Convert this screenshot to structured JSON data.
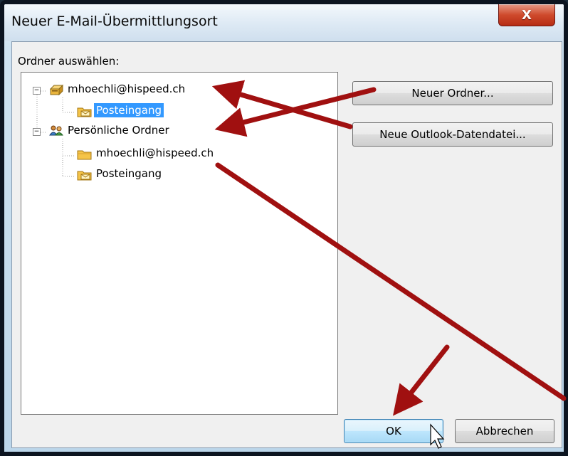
{
  "window": {
    "title": "Neuer E-Mail-Übermittlungsort",
    "close_glyph": "X"
  },
  "tree_label": "Ordner auswählen:",
  "tree": {
    "items": [
      {
        "label": "mhoechli@hispeed.ch",
        "icon": "mailbox-icon",
        "expander": "−"
      },
      {
        "label": "Posteingang",
        "icon": "inbox-folder-icon",
        "selected": true
      },
      {
        "label": "Persönliche Ordner",
        "icon": "personal-folders-icon",
        "expander": "−"
      },
      {
        "label": "mhoechli@hispeed.ch",
        "icon": "folder-icon"
      },
      {
        "label": "Posteingang",
        "icon": "inbox-folder-icon"
      }
    ]
  },
  "buttons": {
    "new_folder": "Neuer Ordner...",
    "new_datafile": "Neue Outlook-Datendatei...",
    "ok": "OK",
    "cancel": "Abbrechen"
  },
  "colors": {
    "selection": "#3399ff",
    "annotation_arrow": "#a01010",
    "close_button": "#cf4a2c"
  }
}
